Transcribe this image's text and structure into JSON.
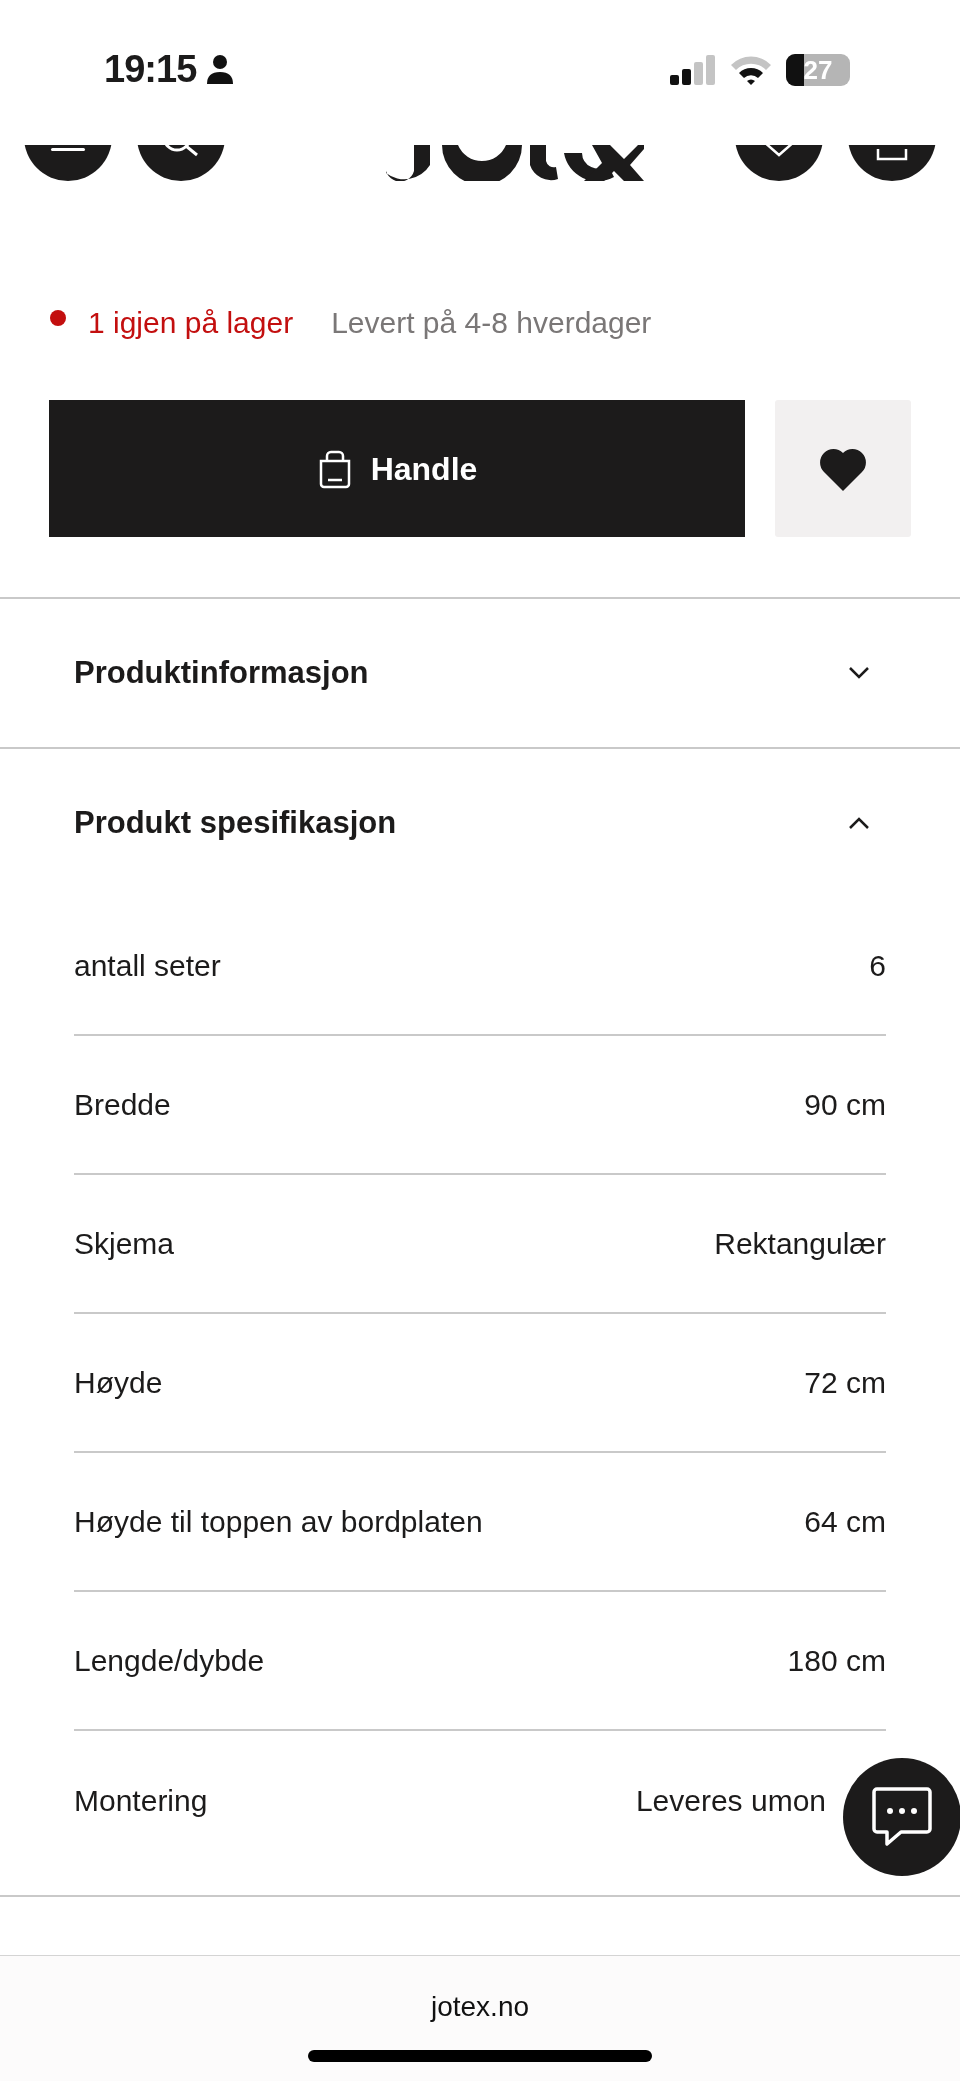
{
  "status_bar": {
    "time": "19:15",
    "battery": "27"
  },
  "stock": {
    "status": "1 igjen på lager",
    "delivery": "Levert på 4-8 hverdager"
  },
  "buy_button": {
    "label": "Handle"
  },
  "sections": [
    {
      "title": "Produktinformasjon",
      "expanded": false
    },
    {
      "title": "Produkt spesifikasjon",
      "expanded": true,
      "specs": [
        {
          "name": "antall seter",
          "value": "6"
        },
        {
          "name": "Bredde",
          "value": "90 cm"
        },
        {
          "name": "Skjema",
          "value": "Rektangulær"
        },
        {
          "name": "Høyde",
          "value": "72 cm"
        },
        {
          "name": "Høyde til toppen av bordplaten",
          "value": "64 cm"
        },
        {
          "name": "Lengde/dybde",
          "value": "180 cm"
        },
        {
          "name": "Montering",
          "value": "Leveres umon"
        }
      ]
    }
  ],
  "browser": {
    "url": "jotex.no"
  }
}
